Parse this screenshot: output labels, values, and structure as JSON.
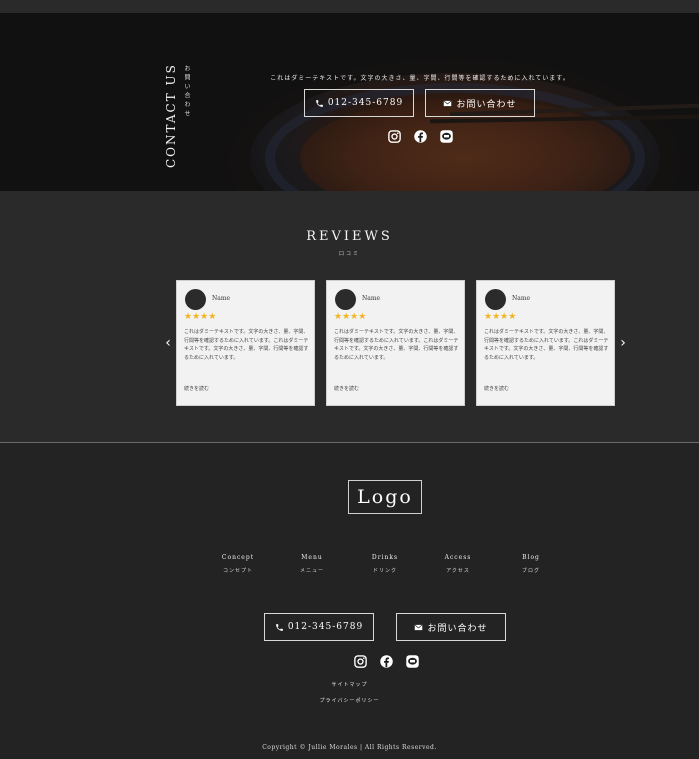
{
  "contact": {
    "title": "CONTACT US",
    "subtitle": "お問い合わせ",
    "dummy_text": "これはダミーテキストです。文字の大きさ、量、字間、行間等を確認するために入れています。",
    "phone_label": "012-345-6789",
    "inquiry_label": "お問い合わせ"
  },
  "reviews": {
    "title": "REVIEWS",
    "subtitle": "口コミ",
    "prev_arrow": "‹",
    "next_arrow": "›",
    "items": [
      {
        "name": "Name",
        "stars": "★★★★",
        "text": "これはダミーテキストです。文字の大きさ、量、字間、行間等を確認するために入れています。これはダミーテキストです。文字の大きさ、量、字間、行間等を確認するために入れています。",
        "more": "続きを読む"
      },
      {
        "name": "Name",
        "stars": "★★★★",
        "text": "これはダミーテキストです。文字の大きさ、量、字間、行間等を確認するために入れています。これはダミーテキストです。文字の大きさ、量、字間、行間等を確認するために入れています。",
        "more": "続きを読む"
      },
      {
        "name": "Name",
        "stars": "★★★★",
        "text": "これはダミーテキストです。文字の大きさ、量、字間、行間等を確認するために入れています。これはダミーテキストです。文字の大きさ、量、字間、行間等を確認するために入れています。",
        "more": "続きを読む"
      }
    ]
  },
  "footer": {
    "logo": "Logo",
    "nav": [
      {
        "en": "Concept",
        "ja": "コンセプト"
      },
      {
        "en": "Menu",
        "ja": "メニュー"
      },
      {
        "en": "Drinks",
        "ja": "ドリンク"
      },
      {
        "en": "Access",
        "ja": "アクセス"
      },
      {
        "en": "Blog",
        "ja": "ブログ"
      }
    ],
    "phone_label": "012-345-6789",
    "inquiry_label": "お問い合わせ",
    "sitemap": "サイトマップ",
    "privacy": "プライバシーポリシー",
    "copyright": "Copyright © Jullie Morales | All Rights Reserved."
  },
  "icons": {
    "instagram": "instagram-icon",
    "facebook": "facebook-icon",
    "line": "line-icon",
    "phone": "phone-icon",
    "mail": "mail-icon"
  },
  "colors": {
    "background": "#1f1f1f",
    "reviews_bg": "#2a2a2a",
    "card_bg": "#f2f2f2",
    "star": "#f2b51e",
    "border": "#d8d8d8"
  }
}
